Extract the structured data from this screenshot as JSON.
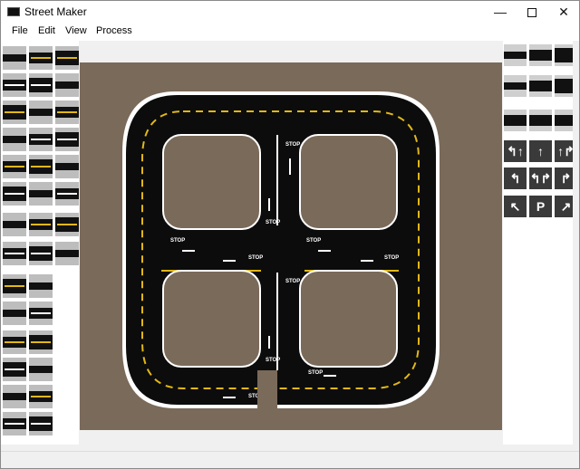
{
  "window": {
    "title": "Street Maker",
    "min_glyph": "—",
    "close_glyph": "✕"
  },
  "menu": {
    "items": [
      "File",
      "Edit",
      "View",
      "Process"
    ]
  },
  "map": {
    "stop_label": "STOP",
    "colors": {
      "ground": "#7a6a5a",
      "road": "#0c0c0c",
      "center_line": "#e2b815",
      "edge_line": "#ffffff"
    }
  },
  "right_palette": {
    "arrows": [
      "↰↑",
      "↑",
      "↑↱",
      "↰",
      "↰↱",
      "↱",
      "↖",
      "P",
      "↗"
    ]
  }
}
